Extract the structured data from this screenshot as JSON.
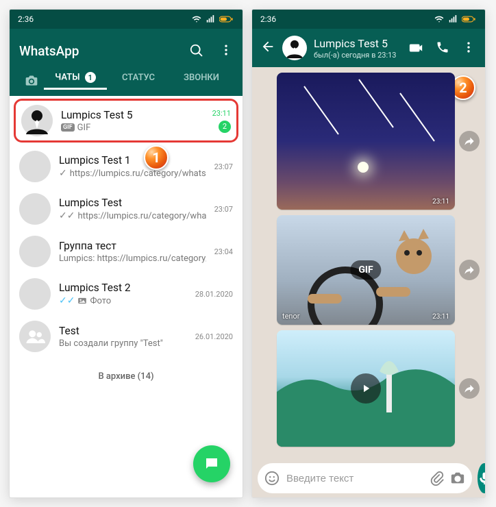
{
  "colors": {
    "primary": "#075e54",
    "accent": "#25d366",
    "highlight": "#e53935"
  },
  "statusbar": {
    "time": "2:36"
  },
  "left": {
    "title": "WhatsApp",
    "tabs": {
      "chats": "ЧАТЫ",
      "status": "СТАТУС",
      "calls": "ЗВОНКИ",
      "badge": "1"
    },
    "archive": "В архиве (14)",
    "chats": [
      {
        "name": "Lumpics Test 5",
        "sub": "GIF",
        "time": "23:11",
        "unread": "2",
        "avatar": "suit",
        "gif": true,
        "hl": true
      },
      {
        "name": "Lumpics Test 1",
        "sub": "https://lumpics.ru/category/whatsap...",
        "time": "23:07",
        "avatar": "orange",
        "tick": "single"
      },
      {
        "name": "Lumpics Test",
        "sub": "https://lumpics.ru/category/whatsap...",
        "time": "23:07",
        "avatar": "orange2",
        "tick": "double"
      },
      {
        "name": "Группа тест",
        "sub": "Lumpics: https://lumpics.ru/category/w...",
        "time": "23:04",
        "avatar": "grp"
      },
      {
        "name": "Lumpics Test 2",
        "sub": "Фото",
        "time": "28.01.2020",
        "avatar": "lime",
        "tick": "blue",
        "photo": true
      },
      {
        "name": "Test",
        "sub": "Вы создали группу \"Test\"",
        "time": "26.01.2020",
        "avatar": "grey"
      }
    ]
  },
  "right": {
    "name": "Lumpics Test 5",
    "status": "был(-а) сегодня в 23:13",
    "input_placeholder": "Введите текст",
    "messages": [
      {
        "kind": "image",
        "time": "23:11"
      },
      {
        "kind": "gif",
        "label": "GIF",
        "source": "tenor",
        "time": "23:11"
      },
      {
        "kind": "video",
        "time": ""
      }
    ]
  },
  "markers": {
    "one": "1",
    "two": "2"
  }
}
